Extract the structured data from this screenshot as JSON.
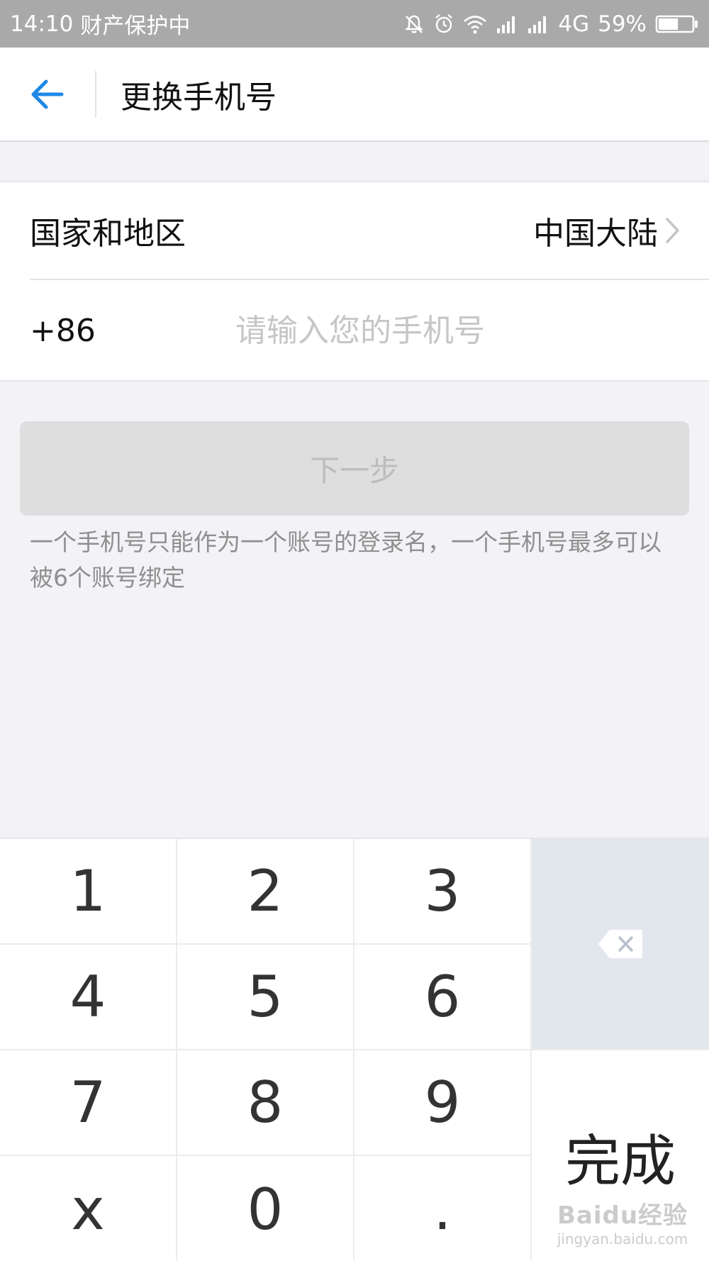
{
  "status_bar": {
    "time": "14:10",
    "status_label": "财产保护中",
    "network": "4G",
    "battery": "59%",
    "battery_level": 0.59,
    "icons": [
      "mute-bell-icon",
      "alarm-icon",
      "wifi-icon",
      "signal-icon",
      "signal-icon",
      "battery-icon"
    ]
  },
  "nav": {
    "title": "更换手机号",
    "back_icon": "back-arrow-icon"
  },
  "form": {
    "region_label": "国家和地区",
    "region_value": "中国大陆",
    "country_code": "+86",
    "phone_value": "",
    "phone_placeholder": "请输入您的手机号"
  },
  "next_button": {
    "label": "下一步",
    "enabled": false
  },
  "hint": "一个手机号只能作为一个账号的登录名，一个手机号最多可以被6个账号绑定",
  "keypad": {
    "keys": [
      "1",
      "2",
      "3",
      "4",
      "5",
      "6",
      "7",
      "8",
      "9",
      "x",
      "0",
      "."
    ],
    "done_label": "完成",
    "delete_icon": "backspace-icon"
  },
  "watermark": {
    "brand": "Baidu经验",
    "url": "jingyan.baidu.com"
  },
  "colors": {
    "accent": "#1e88e5",
    "status_bar": "#a9a9a9",
    "background": "#f3f3f7",
    "button_disabled": "#dedede",
    "delete_key": "#e2e6ed"
  }
}
